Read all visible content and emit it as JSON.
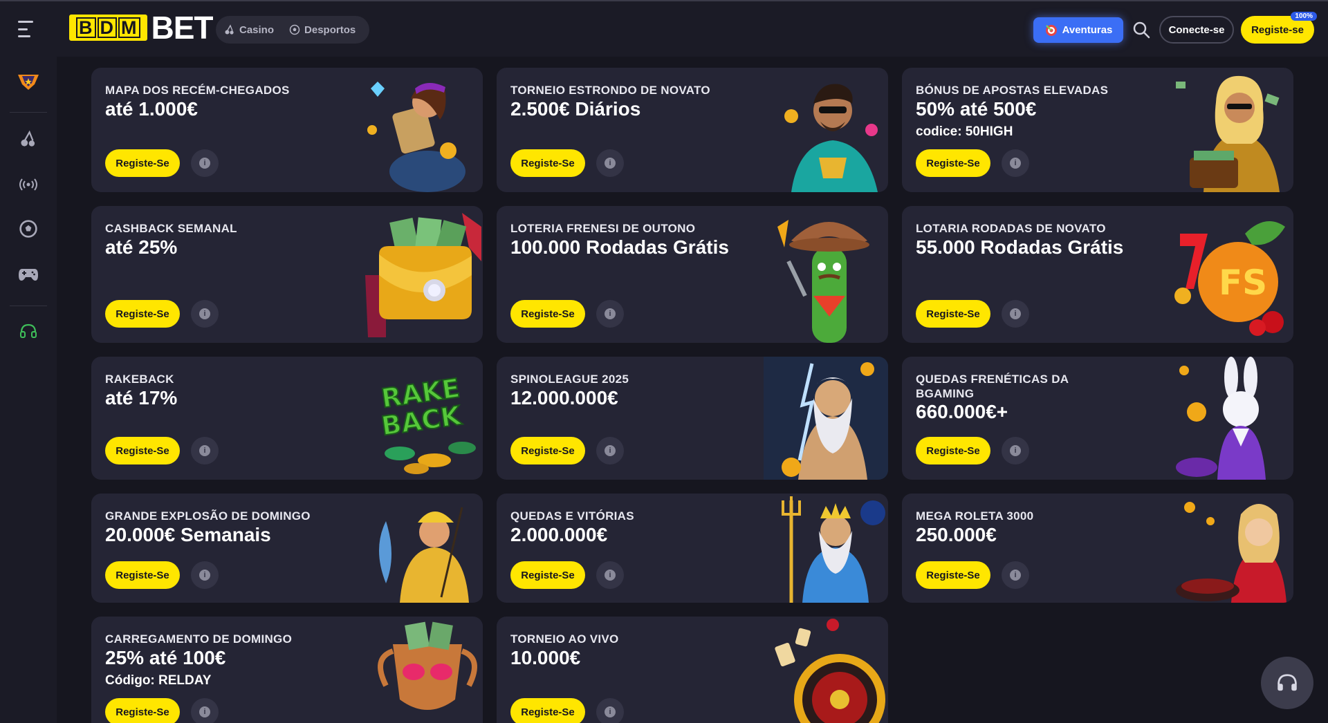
{
  "header": {
    "logo_text_boxed": [
      "B",
      "D",
      "M"
    ],
    "logo_text_bet": "BET",
    "nav": [
      {
        "label": "Casino",
        "icon": "cherries-icon"
      },
      {
        "label": "Desportos",
        "icon": "football-icon"
      }
    ],
    "adventures_label": "Aventuras",
    "connect_label": "Conecte-se",
    "register_label": "Registe-se",
    "register_badge": "100%"
  },
  "sidebar": {
    "items": [
      "promotions-badge-icon",
      "cherries-icon",
      "live-broadcast-icon",
      "football-icon",
      "gamepad-icon",
      "headset-icon"
    ]
  },
  "cards": [
    {
      "title": "Mapa dos recém-chegados",
      "amount": "até 1.000€",
      "code": "",
      "button": "Registe-Se",
      "art": "adventurer-woman-with-map"
    },
    {
      "title": "Torneio Estrondo de Novato",
      "amount": "2.500€ Diários",
      "code": "",
      "button": "Registe-Se",
      "art": "man-with-gold-cup"
    },
    {
      "title": "Bónus de apostas elevadas",
      "amount": "50% até 500€",
      "code": "codice: 50HIGH",
      "button": "Registe-Se",
      "art": "woman-with-money-suitcase"
    },
    {
      "title": "Cashback semanal",
      "amount": "até 25%",
      "code": "",
      "button": "Registe-Se",
      "art": "golden-wallet"
    },
    {
      "title": "Loteria Frenesi de Outono",
      "amount": "100.000 Rodadas Grátis",
      "code": "",
      "button": "Registe-Se",
      "art": "cactus-cowboy"
    },
    {
      "title": "Lotaria Rodadas de Novato",
      "amount": "55.000 Rodadas Grátis",
      "code": "",
      "button": "Registe-Se",
      "art": "fs-orange-seven"
    },
    {
      "title": "Rakeback",
      "amount": "até 17%",
      "code": "",
      "button": "Registe-Se",
      "art": "rake-back-chips"
    },
    {
      "title": "SpinoLeague 2025",
      "amount": "12.000.000€",
      "code": "",
      "button": "Registe-Se",
      "art": "zeus-lightning"
    },
    {
      "title": "Quedas Frenéticas da BGaming",
      "amount": "660.000€+",
      "code": "",
      "button": "Registe-Se",
      "art": "rabbit-in-suit"
    },
    {
      "title": "Grande Explosão de Domingo",
      "amount": "20.000€ Semanais",
      "code": "",
      "button": "Registe-Se",
      "art": "fisherman"
    },
    {
      "title": "Quedas e Vitórias",
      "amount": "2.000.000€",
      "code": "",
      "button": "Registe-Se",
      "art": "poseidon-drops-wins"
    },
    {
      "title": "Mega Roleta 3000",
      "amount": "250.000€",
      "code": "",
      "button": "Registe-Se",
      "art": "roulette-host"
    },
    {
      "title": "Carregamento de Domingo",
      "amount": "25% até 100€",
      "code": "Código: RELDAY",
      "button": "Registe-Se",
      "art": "gold-trophy-sunglasses"
    },
    {
      "title": "Torneio ao Vivo",
      "amount": "10.000€",
      "code": "",
      "button": "Registe-Se",
      "art": "roulette-wheel"
    }
  ],
  "colors": {
    "background": "#16161f",
    "card": "#252535",
    "accent": "#ffe600",
    "adventures": "#3b6ef5"
  }
}
